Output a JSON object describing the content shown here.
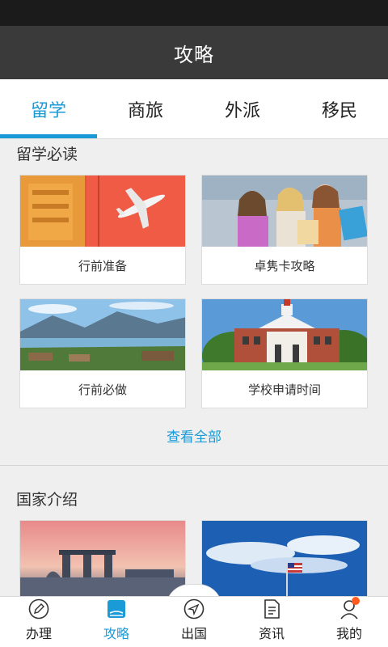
{
  "header": {
    "title": "攻略"
  },
  "tabs": [
    {
      "label": "留学",
      "active": true
    },
    {
      "label": "商旅",
      "active": false
    },
    {
      "label": "外派",
      "active": false
    },
    {
      "label": "移民",
      "active": false
    }
  ],
  "study": {
    "section_title": "留学必读",
    "cards": [
      {
        "label": "行前准备",
        "image": "luggage-airplane-photo"
      },
      {
        "label": "卓隽卡攻略",
        "image": "shopping-girls-photo"
      },
      {
        "label": "行前必做",
        "image": "lake-mountains-photo"
      },
      {
        "label": "学校申请时间",
        "image": "university-building-photo"
      }
    ],
    "see_all": "查看全部"
  },
  "countries": {
    "section_title": "国家介绍",
    "cards": [
      {
        "image": "singapore-skyline-photo"
      },
      {
        "image": "usa-flag-sky-photo"
      }
    ]
  },
  "bottom_nav": [
    {
      "label": "办理",
      "icon": "pen-icon",
      "active": false
    },
    {
      "label": "攻略",
      "icon": "guide-book-icon",
      "active": true
    },
    {
      "label": "出国",
      "icon": "compass-icon",
      "active": false
    },
    {
      "label": "资讯",
      "icon": "document-icon",
      "active": false
    },
    {
      "label": "我的",
      "icon": "user-icon",
      "active": false
    }
  ],
  "colors": {
    "accent": "#1a9ad6",
    "title_bar": "#3a3a3a",
    "status_bar": "#1b1b1b",
    "notification_dot": "#ff5a1f"
  }
}
